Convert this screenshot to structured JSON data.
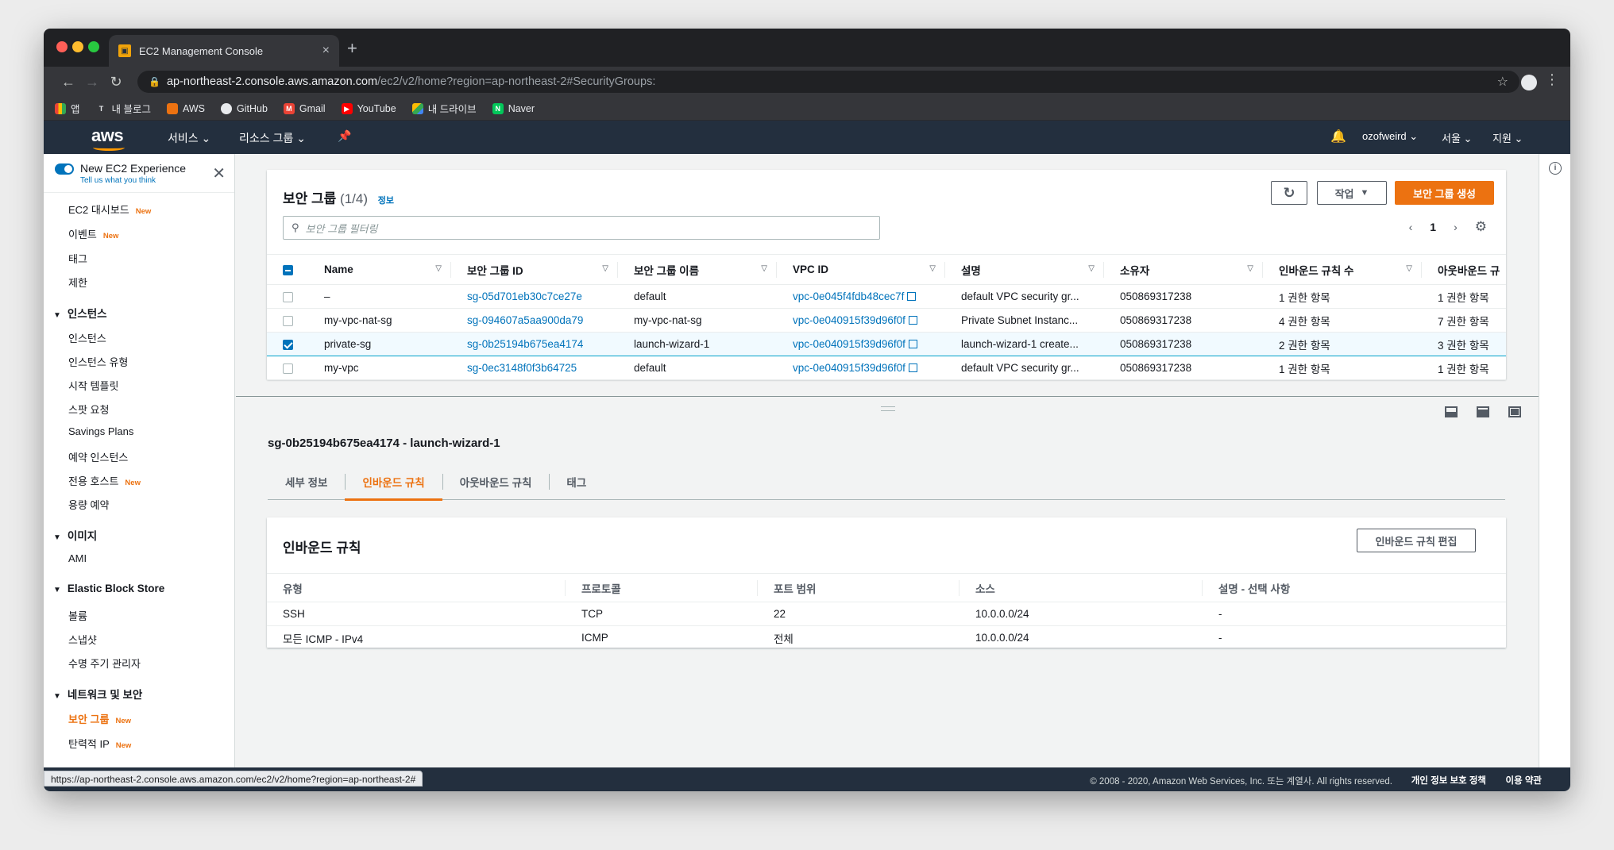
{
  "browser": {
    "tab_title": "EC2 Management Console",
    "url_host": "ap-northeast-2.console.aws.amazon.com",
    "url_path": "/ec2/v2/home?region=ap-northeast-2#SecurityGroups:",
    "bookmarks": [
      "앱",
      "내 블로그",
      "AWS",
      "GitHub",
      "Gmail",
      "YouTube",
      "내 드라이브",
      "Naver"
    ],
    "status_url": "https://ap-northeast-2.console.aws.amazon.com/ec2/v2/home?region=ap-northeast-2#"
  },
  "awsnav": {
    "logo": "aws",
    "services": "서비스",
    "resource_groups": "리소스 그룹",
    "user": "ozofweird",
    "region": "서울",
    "support": "지원"
  },
  "sidebar": {
    "new_experience": "New EC2 Experience",
    "tell_us": "Tell us what you think",
    "new_badge": "New",
    "top_items": [
      "EC2 대시보드",
      "이벤트",
      "태그",
      "제한"
    ],
    "sections": {
      "instances": "인스턴스",
      "images": "이미지",
      "ebs": "Elastic Block Store",
      "network": "네트워크 및 보안"
    },
    "instance_items": [
      "인스턴스",
      "인스턴스 유형",
      "시작 템플릿",
      "스팟 요청",
      "Savings Plans",
      "예약 인스턴스",
      "전용 호스트",
      "용량 예약"
    ],
    "image_items": [
      "AMI"
    ],
    "ebs_items": [
      "볼륨",
      "스냅샷",
      "수명 주기 관리자"
    ],
    "network_items": [
      "보안 그룹",
      "탄력적 IP"
    ]
  },
  "sg_panel": {
    "title": "보안 그룹",
    "count": "(1/4)",
    "info": "정보",
    "actions": "작업",
    "create": "보안 그룹 생성",
    "filter_placeholder": "보안 그룹 필터링",
    "page": "1",
    "columns": [
      "Name",
      "보안 그룹 ID",
      "보안 그룹 이름",
      "VPC ID",
      "설명",
      "소유자",
      "인바운드 규칙 수",
      "아웃바운드 규"
    ],
    "rows": [
      {
        "name": "–",
        "id": "sg-05d701eb30c7ce27e",
        "group_name": "default",
        "vpc": "vpc-0e045f4fdb48cec7f",
        "desc": "default VPC security gr...",
        "owner": "050869317238",
        "inbound": "1 권한 항목",
        "outbound": "1 권한 항목",
        "selected": false
      },
      {
        "name": "my-vpc-nat-sg",
        "id": "sg-094607a5aa900da79",
        "group_name": "my-vpc-nat-sg",
        "vpc": "vpc-0e040915f39d96f0f",
        "desc": "Private Subnet Instanc...",
        "owner": "050869317238",
        "inbound": "4 권한 항목",
        "outbound": "7 권한 항목",
        "selected": false
      },
      {
        "name": "private-sg",
        "id": "sg-0b25194b675ea4174",
        "group_name": "launch-wizard-1",
        "vpc": "vpc-0e040915f39d96f0f",
        "desc": "launch-wizard-1 create...",
        "owner": "050869317238",
        "inbound": "2 권한 항목",
        "outbound": "3 권한 항목",
        "selected": true
      },
      {
        "name": "my-vpc",
        "id": "sg-0ec3148f0f3b64725",
        "group_name": "default",
        "vpc": "vpc-0e040915f39d96f0f",
        "desc": "default VPC security gr...",
        "owner": "050869317238",
        "inbound": "1 권한 항목",
        "outbound": "1 권한 항목",
        "selected": false
      }
    ]
  },
  "detail": {
    "title": "sg-0b25194b675ea4174 - launch-wizard-1",
    "tabs": [
      "세부 정보",
      "인바운드 규칙",
      "아웃바운드 규칙",
      "태그"
    ],
    "active_tab": "인바운드 규칙"
  },
  "inbound": {
    "title": "인바운드 규칙",
    "edit": "인바운드 규칙 편집",
    "columns": [
      "유형",
      "프로토콜",
      "포트 범위",
      "소스",
      "설명 - 선택 사항"
    ],
    "rows": [
      [
        "SSH",
        "TCP",
        "22",
        "10.0.0.0/24",
        "-"
      ],
      [
        "모든 ICMP - IPv4",
        "ICMP",
        "전체",
        "10.0.0.0/24",
        "-"
      ]
    ]
  },
  "footer": {
    "copyright": "© 2008 - 2020, Amazon Web Services, Inc. 또는 계열사. All rights reserved.",
    "privacy": "개인 정보 보호 정책",
    "terms": "이용 약관"
  },
  "colors": {
    "accent": "#ec7211",
    "link": "#0073bb",
    "nav_bg": "#232f3e"
  }
}
